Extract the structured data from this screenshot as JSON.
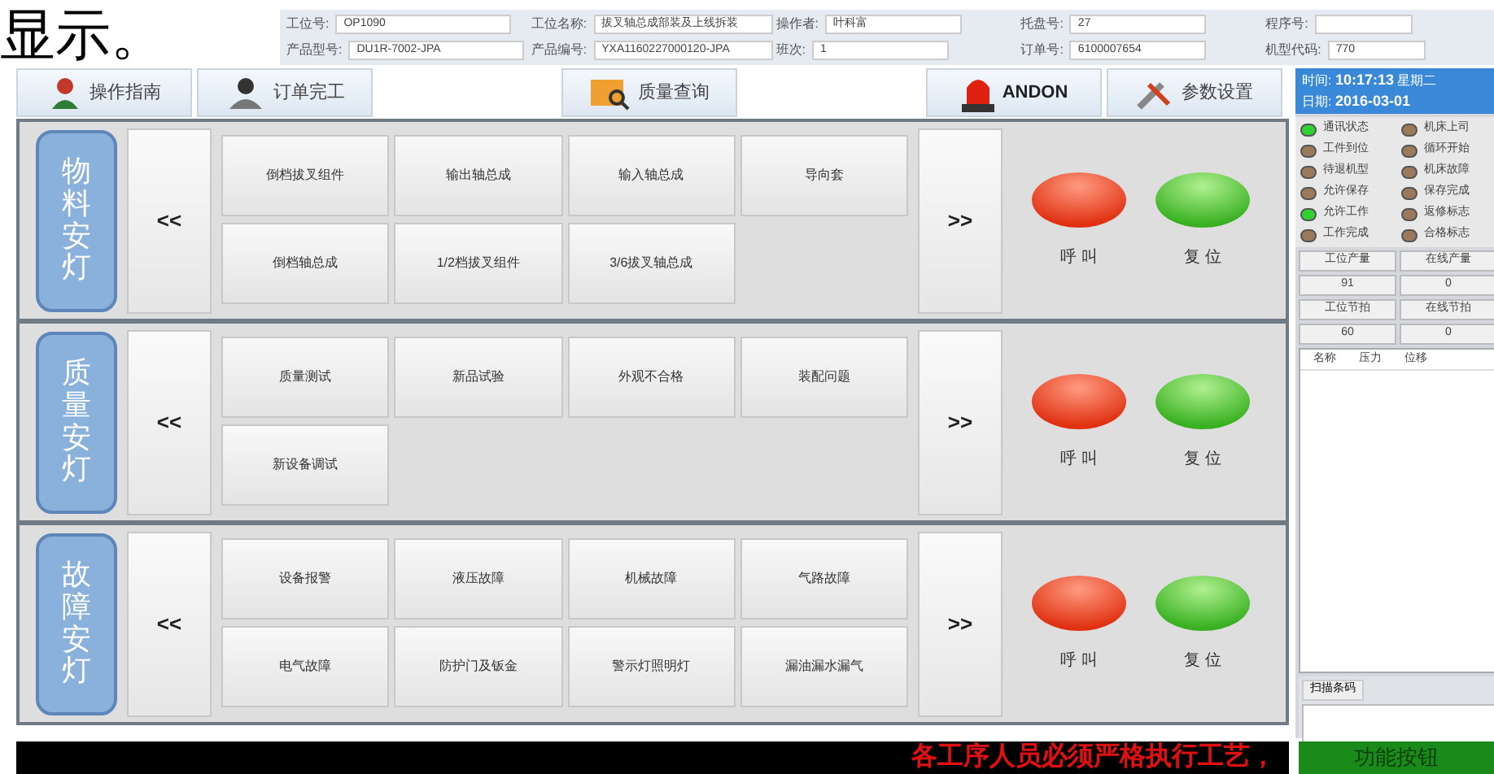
{
  "caption": "显示。",
  "info_fields": [
    {
      "label": "工位号:",
      "value": "OP1090"
    },
    {
      "label": "工位名称:",
      "value": "拔叉轴总成部装及上线拆装"
    },
    {
      "label": "操作者:",
      "value": "叶科富"
    },
    {
      "label": "托盘号:",
      "value": "27"
    },
    {
      "label": "程序号:"
    },
    {
      "label": "产品型号:",
      "value": "DU1R-7002-JPA"
    },
    {
      "label": "产品编号:",
      "value": "YXA1160227000120-JPA"
    },
    {
      "label": "班次:",
      "value": "1"
    },
    {
      "label": "订单号:",
      "value": "6100007654"
    },
    {
      "label": "机型代码:",
      "value": "770"
    }
  ],
  "tabs": [
    {
      "label": "操作指南"
    },
    {
      "label": "订单完工"
    },
    {
      "label": "质量查询"
    },
    {
      "label": "ANDON"
    },
    {
      "label": "参数设置"
    }
  ],
  "sections": [
    {
      "title": "物料安灯",
      "prev": "<<",
      "next": ">>",
      "buttons": [
        "倒档拔叉组件",
        "输出轴总成",
        "输入轴总成",
        "导向套",
        "倒档轴总成",
        "1/2档拔叉组件",
        "3/6拔叉轴总成"
      ],
      "call": "呼 叫",
      "reset": "复 位"
    },
    {
      "title": "质量安灯",
      "prev": "<<",
      "next": ">>",
      "buttons": [
        "质量测试",
        "新品试验",
        "外观不合格",
        "装配问题",
        "新设备调试"
      ],
      "call": "呼 叫",
      "reset": "复 位"
    },
    {
      "title": "故障安灯",
      "prev": "<<",
      "next": ">>",
      "buttons": [
        "设备报警",
        "液压故障",
        "机械故障",
        "气路故障",
        "电气故障",
        "防护门及钣金",
        "警示灯照明灯",
        "漏油漏水漏气"
      ],
      "call": "呼 叫",
      "reset": "复 位"
    }
  ],
  "clock": {
    "time_label": "时间:",
    "time": "10:17:13",
    "weekday": "星期二",
    "date_label": "日期:",
    "date": "2016-03-01"
  },
  "indicators": [
    {
      "label": "通讯状态",
      "on": true
    },
    {
      "label": "机床上司",
      "on": false
    },
    {
      "label": "工件到位",
      "on": false
    },
    {
      "label": "循环开始",
      "on": false
    },
    {
      "label": "待退机型",
      "on": false
    },
    {
      "label": "机床故障",
      "on": false
    },
    {
      "label": "允许保存",
      "on": false
    },
    {
      "label": "保存完成",
      "on": false
    },
    {
      "label": "允许工作",
      "on": true
    },
    {
      "label": "返修标志",
      "on": false
    },
    {
      "label": "工作完成",
      "on": false
    },
    {
      "label": "合格标志",
      "on": false
    }
  ],
  "stats": [
    "工位产量",
    "在线产量",
    "91",
    "0",
    "工位节拍",
    "在线节拍",
    "60",
    "0"
  ],
  "table": {
    "columns": [
      "名称",
      "压力",
      "位移"
    ]
  },
  "scan": {
    "label": "扫描条码"
  },
  "marquee": "各工序人员必须严格执行工艺，",
  "function_button": "功能按钮"
}
